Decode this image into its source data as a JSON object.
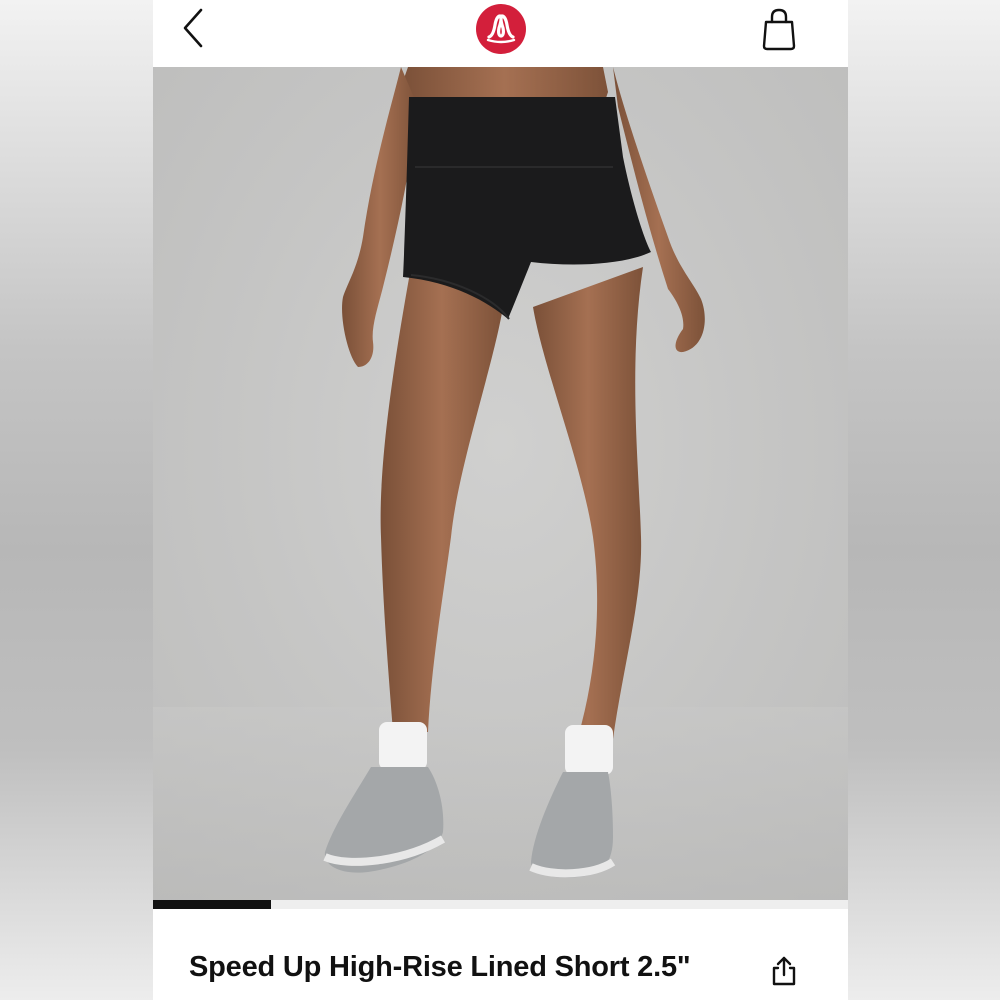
{
  "header": {
    "back_icon": "chevron-left-icon",
    "logo_icon": "lululemon-logo-icon",
    "bag_icon": "shopping-bag-icon",
    "brand_color": "#d31f3b"
  },
  "gallery": {
    "image_description_icon": "product-photo",
    "background_color": "#c6c6c5",
    "progress": 0.17
  },
  "product": {
    "title": "Speed Up High-Rise Lined Short 2.5\"",
    "share_icon": "share-icon"
  }
}
